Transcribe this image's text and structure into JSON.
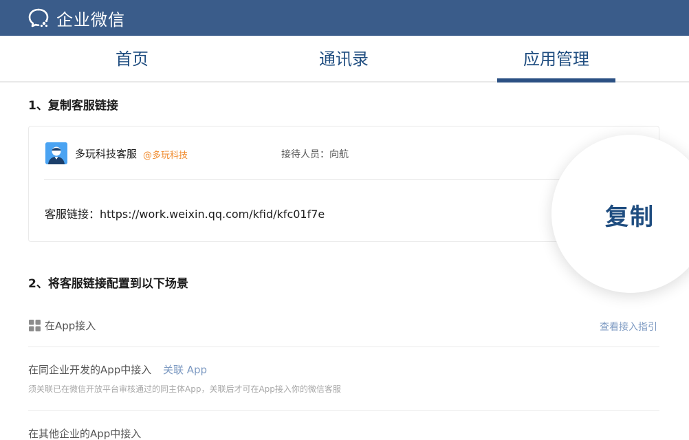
{
  "header": {
    "app_title": "企业微信",
    "logo_icon": "wecom-chat-bubble-icon",
    "bg_color": "#3a5c8a"
  },
  "tabs": [
    {
      "label": "首页",
      "active": false
    },
    {
      "label": "通讯录",
      "active": false
    },
    {
      "label": "应用管理",
      "active": true
    }
  ],
  "section1": {
    "title": "1、复制客服链接",
    "kf_name": "多玩科技客服",
    "kf_corp": "@多玩科技",
    "reception_label": "接待人员：",
    "reception_person": "向航",
    "link_label": "客服链接：",
    "link_url": "https://work.weixin.qq.com/kfid/kfc01f7e",
    "copy_label": "复制",
    "avatar_icon": "customer-service-avatar-icon"
  },
  "section2": {
    "title": "2、将客服链接配置到以下场景",
    "app_access_label": "在App接入",
    "app_access_icon": "grid-apps-icon",
    "guide_link": "查看接入指引",
    "same_corp_label": "在同企业开发的App中接入",
    "link_app": "关联 App",
    "same_corp_note": "须关联已在微信开放平台审核通过的同主体App，关联后才可在App接入你的微信客服",
    "other_corp_label": "在其他企业的App中接入"
  },
  "colors": {
    "accent": "#1f4d80",
    "link": "#7d9ac2",
    "corp_tag": "#f08a2c"
  }
}
